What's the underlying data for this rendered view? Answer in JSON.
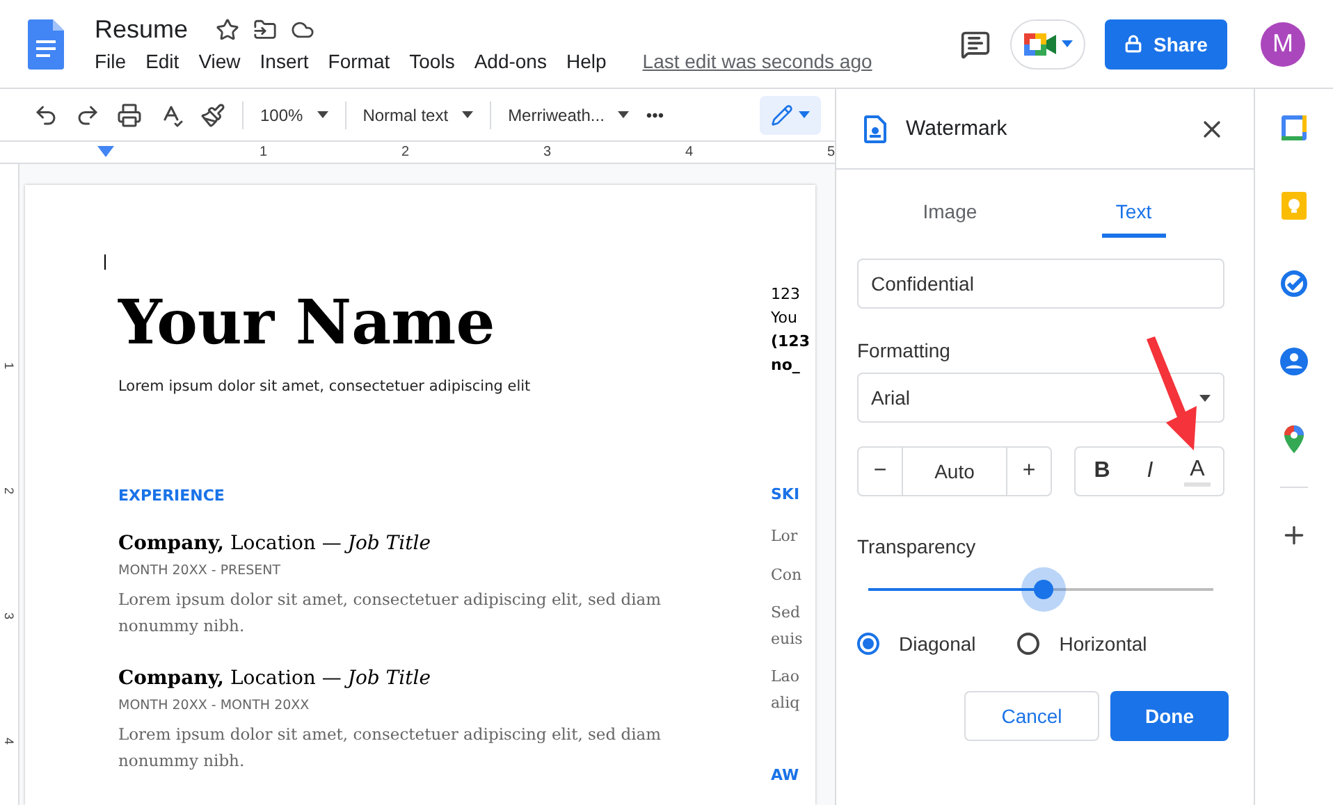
{
  "header": {
    "title": "Resume",
    "menu": [
      "File",
      "Edit",
      "View",
      "Insert",
      "Format",
      "Tools",
      "Add-ons",
      "Help"
    ],
    "last_edit": "Last edit was seconds ago",
    "share": "Share",
    "avatar": "M"
  },
  "toolbar": {
    "zoom": "100%",
    "style": "Normal text",
    "font": "Merriweath...",
    "more": "•••"
  },
  "ruler": {
    "marks": [
      "1",
      "2",
      "3",
      "4",
      "5"
    ],
    "vertical_marks": [
      "1",
      "2",
      "3",
      "4"
    ]
  },
  "document": {
    "name": "Your Name",
    "tagline": "Lorem ipsum dolor sit amet, consectetuer adipiscing elit",
    "section": "EXPERIENCE",
    "jobs": [
      {
        "company": "Company,",
        "location": "Location — ",
        "title": "Job Title",
        "dates": "MONTH 20XX - PRESENT",
        "text": "Lorem ipsum dolor sit amet, consectetuer adipiscing elit, sed diam nonummy nibh."
      },
      {
        "company": "Company,",
        "location": "Location — ",
        "title": "Job Title",
        "dates": "MONTH 20XX - MONTH 20XX",
        "text": "Lorem ipsum dolor sit amet, consectetuer adipiscing elit, sed diam nonummy nibh."
      }
    ],
    "contact": [
      {
        "text": "123",
        "bold": false
      },
      {
        "text": "You",
        "bold": false
      },
      {
        "text": "(123",
        "bold": true
      },
      {
        "text": "no_",
        "bold": true
      }
    ],
    "side_heading": "SKI",
    "side_lines": [
      "Lor",
      "Con",
      "Sed",
      "euis",
      "Lao",
      "aliq"
    ],
    "side_heading_2": "AW"
  },
  "panel": {
    "title": "Watermark",
    "tabs": [
      {
        "label": "Image",
        "selected": false
      },
      {
        "label": "Text",
        "selected": true
      }
    ],
    "text_value": "Confidential",
    "formatting_label": "Formatting",
    "font": "Arial",
    "decrease": "−",
    "size": "Auto",
    "increase": "+",
    "bold": "B",
    "italic": "I",
    "text_color_label": "A",
    "transparency_label": "Transparency",
    "transparency": {
      "level": 0.51
    },
    "orientation": [
      {
        "label": "Diagonal",
        "selected": true
      },
      {
        "label": "Horizontal",
        "selected": false
      }
    ],
    "cancel": "Cancel",
    "done": "Done"
  }
}
